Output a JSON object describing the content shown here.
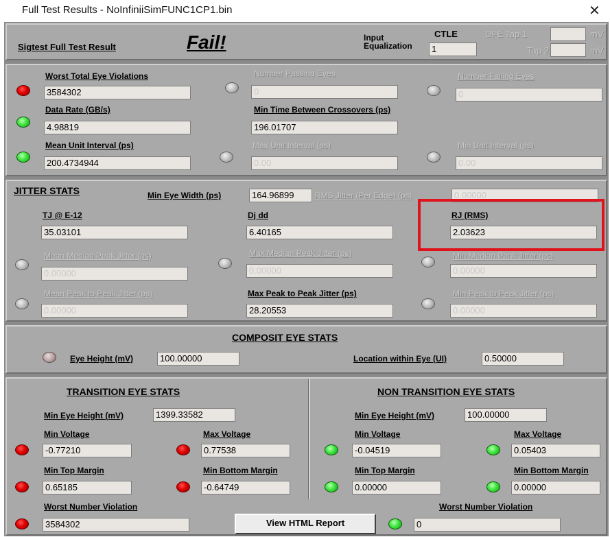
{
  "window": {
    "title": "Full Test Results - NoInfiniiSimFUNC1CP1.bin",
    "close": "✕"
  },
  "header": {
    "result_label": "Sigtest Full Test Result",
    "result_value": "Fail!",
    "input_eq_label_1": "Input",
    "input_eq_label_2": "Equalization",
    "ctle_label": "CTLE",
    "ctle_value": "1",
    "dfe_tap1_label": "DFE Tap 1",
    "dfe_tap2_label": "Tap 2",
    "mv_1": "mV",
    "mv_2": "mV"
  },
  "eyes": {
    "worst_total_label": "Worst Total Eye Violations",
    "worst_total_value": "3584302",
    "num_passing_label": "Number Passing Eyes",
    "num_passing_value": "0",
    "num_failing_label": "Number Failing Eyes",
    "num_failing_value": "0",
    "data_rate_label": "Data Rate (GB/s)",
    "data_rate_value": "4.98819",
    "min_time_label": "Min Time Between Crossovers (ps)",
    "min_time_value": "196.01707",
    "mean_ui_label": "Mean Unit Interval (ps)",
    "mean_ui_value": "200.4734944",
    "max_ui_label": "Max Unit Interval (ps)",
    "max_ui_value": "0.00",
    "min_ui_label": "Min Unit Interval (ps)",
    "min_ui_value": "0.00"
  },
  "jitter": {
    "title": "JITTER STATS",
    "min_eye_width_label": "Min Eye Width (ps)",
    "min_eye_width_value": "164.96899",
    "rms_jitter_label": "RMS Jitter (Per Edge) (ps)",
    "rms_jitter_value": "0.00000",
    "tj_label": "TJ @ E-12",
    "tj_value": "35.03101",
    "djdd_label": "Dj dd",
    "djdd_value": "6.40165",
    "rj_label": "RJ (RMS)",
    "rj_value": "2.03623",
    "mean_median_label": "Mean Median Peak Jitter (ps)",
    "mean_median_value": "0.00000",
    "max_median_label": "Max Median Peak Jitter (ps)",
    "max_median_value": "0.00000",
    "min_median_label": "Min Median Peak Jitter (ps)",
    "min_median_value": "0.00000",
    "mean_p2p_label": "Mean Peak to Peak Jitter (ps)",
    "mean_p2p_value": "0.00000",
    "max_p2p_label": "Max Peak to Peak Jitter (ps)",
    "max_p2p_value": "28.20553",
    "min_p2p_label": "Min Peak to Peak Jitter (ps)",
    "min_p2p_value": "0.00000"
  },
  "composit": {
    "title": "COMPOSIT EYE STATS",
    "eye_height_label": "Eye Height (mV)",
    "eye_height_value": "100.00000",
    "location_label": "Location within Eye (UI)",
    "location_value": "0.50000"
  },
  "transition": {
    "title": "TRANSITION EYE STATS",
    "min_eye_height_label": "Min Eye Height (mV)",
    "min_eye_height_value": "1399.33582",
    "min_voltage_label": "Min Voltage",
    "min_voltage_value": "-0.77210",
    "max_voltage_label": "Max Voltage",
    "max_voltage_value": "0.77538",
    "min_top_label": "Min Top Margin",
    "min_top_value": "0.65185",
    "min_bottom_label": "Min Bottom Margin",
    "min_bottom_value": "-0.64749",
    "worst_label": "Worst Number Violation",
    "worst_value": "3584302"
  },
  "non_transition": {
    "title": "NON TRANSITION EYE STATS",
    "min_eye_height_label": "Min Eye Height (mV)",
    "min_eye_height_value": "100.00000",
    "min_voltage_label": "Min Voltage",
    "min_voltage_value": "-0.04519",
    "max_voltage_label": "Max Voltage",
    "max_voltage_value": "0.05403",
    "min_top_label": "Min Top Margin",
    "min_top_value": "0.00000",
    "min_bottom_label": "Min Bottom Margin",
    "min_bottom_value": "0.00000",
    "worst_label": "Worst Number Violation",
    "worst_value": "0"
  },
  "actions": {
    "view_html_report": "View HTML Report"
  },
  "colors": {
    "fail_led": "#e00000",
    "pass_led": "#3fe63f",
    "highlight": "#e0121c",
    "panel": "#a9a9a9"
  }
}
